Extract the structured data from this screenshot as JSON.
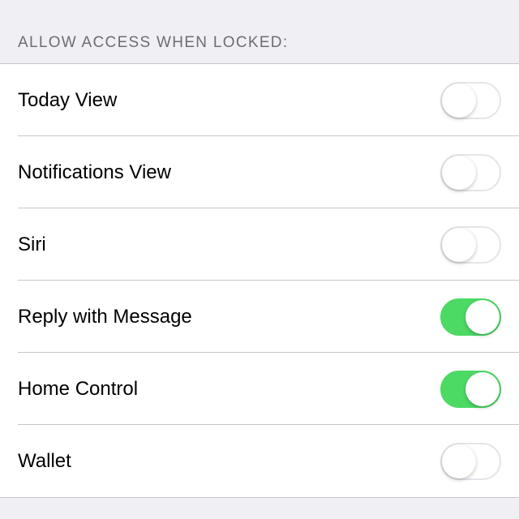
{
  "section": {
    "header": "ALLOW ACCESS WHEN LOCKED:",
    "items": [
      {
        "label": "Today View",
        "on": false
      },
      {
        "label": "Notifications View",
        "on": false
      },
      {
        "label": "Siri",
        "on": false
      },
      {
        "label": "Reply with Message",
        "on": true
      },
      {
        "label": "Home Control",
        "on": true
      },
      {
        "label": "Wallet",
        "on": false
      }
    ]
  }
}
